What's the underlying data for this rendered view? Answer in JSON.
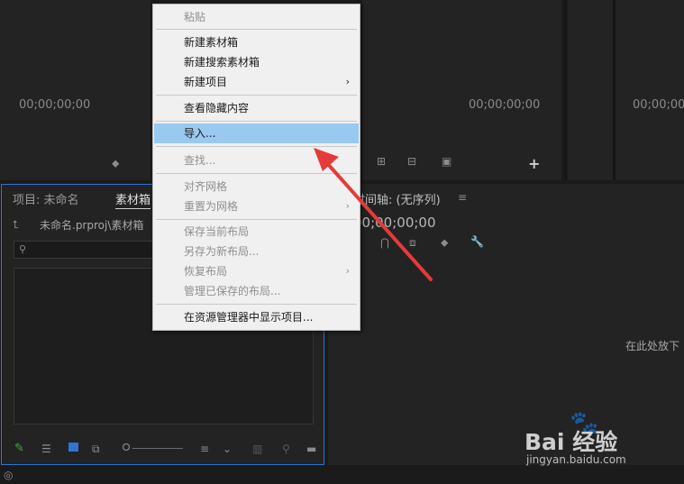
{
  "top_panels": {
    "timecode_left": "00;00;00;00",
    "timecode_mid": "00;00;00;00",
    "timecode_right": "00;00;00;00"
  },
  "project_panel": {
    "tab_project": "项目: 未命名",
    "tab_bin": "素材箱",
    "path": "未命名.prproj\\素材箱"
  },
  "timeline_panel": {
    "title": "时间轴: (无序列)",
    "timecode": "00;00;00;00",
    "drop_hint": "在此处放下"
  },
  "context_menu": {
    "paste": "粘贴",
    "new_bin": "新建素材箱",
    "new_search_bin": "新建搜索素材箱",
    "new_item": "新建项目",
    "show_hidden": "查看隐藏内容",
    "import": "导入...",
    "find": "查找...",
    "align_grid": "对齐网格",
    "reset_grid": "重置为网格",
    "save_layout": "保存当前布局",
    "save_new_layout": "另存为新布局...",
    "restore_layout": "恢复布局",
    "manage_layouts": "管理已保存的布局...",
    "reveal_explorer": "在资源管理器中显示项目..."
  },
  "watermark": {
    "brand": "Bai 经验",
    "url": "jingyan.baidu.com"
  },
  "colors": {
    "highlight": "#99c9ef",
    "panel_border_active": "#2f74d4",
    "arrow": "#e53a3a"
  }
}
